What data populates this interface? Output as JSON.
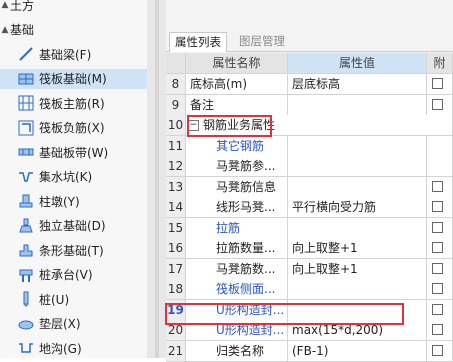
{
  "tree": {
    "items": [
      {
        "label": "土方",
        "icon": "folder-icon",
        "kind": "group"
      },
      {
        "label": "基础",
        "icon": "folder-icon",
        "kind": "group"
      },
      {
        "label": "基础梁(F)",
        "icon": "beam-icon",
        "kind": "item"
      },
      {
        "label": "筏板基础(M)",
        "icon": "raft-foundation-icon",
        "kind": "item",
        "selected": true
      },
      {
        "label": "筏板主筋(R)",
        "icon": "main-rebar-icon",
        "kind": "item"
      },
      {
        "label": "筏板负筋(X)",
        "icon": "negative-rebar-icon",
        "kind": "item"
      },
      {
        "label": "基础板带(W)",
        "icon": "slab-strip-icon",
        "kind": "item"
      },
      {
        "label": "集水坑(K)",
        "icon": "sump-pit-icon",
        "kind": "item"
      },
      {
        "label": "柱墩(Y)",
        "icon": "pier-icon",
        "kind": "item"
      },
      {
        "label": "独立基础(D)",
        "icon": "isolated-footing-icon",
        "kind": "item"
      },
      {
        "label": "条形基础(T)",
        "icon": "strip-footing-icon",
        "kind": "item"
      },
      {
        "label": "桩承台(V)",
        "icon": "pile-cap-icon",
        "kind": "item"
      },
      {
        "label": "桩(U)",
        "icon": "pile-icon",
        "kind": "item"
      },
      {
        "label": "垫层(X)",
        "icon": "cushion-icon",
        "kind": "item"
      },
      {
        "label": "地沟(G)",
        "icon": "trench-icon",
        "kind": "item"
      }
    ]
  },
  "panel": {
    "tabs": [
      {
        "label": "属性列表",
        "active": true
      },
      {
        "label": "图层管理",
        "active": false
      }
    ],
    "columns": {
      "name": "属性名称",
      "value": "属性值",
      "attach": "附"
    },
    "rows": [
      {
        "num": "8",
        "name": "底标高(m)",
        "value": "层底标高",
        "blue": false,
        "checkbox": true
      },
      {
        "num": "9",
        "name": "备注",
        "value": "",
        "blue": false,
        "checkbox": true
      },
      {
        "num": "10",
        "name": "钢筋业务属性",
        "value": "",
        "blue": false,
        "checkbox": false,
        "group": true
      },
      {
        "num": "11",
        "name": "其它钢筋",
        "value": "",
        "blue": true,
        "checkbox": false
      },
      {
        "num": "12",
        "name": "马凳筋参...",
        "value": "",
        "blue": false,
        "checkbox": false
      },
      {
        "num": "13",
        "name": "马凳筋信息",
        "value": "",
        "blue": false,
        "checkbox": true
      },
      {
        "num": "14",
        "name": "线形马凳...",
        "value": "平行横向受力筋",
        "blue": false,
        "checkbox": true
      },
      {
        "num": "15",
        "name": "拉筋",
        "value": "",
        "blue": true,
        "checkbox": true
      },
      {
        "num": "16",
        "name": "拉筋数量...",
        "value": "向上取整+1",
        "blue": false,
        "checkbox": true
      },
      {
        "num": "17",
        "name": "马凳筋数...",
        "value": "向上取整+1",
        "blue": false,
        "checkbox": true
      },
      {
        "num": "18",
        "name": "筏板侧面...",
        "value": "",
        "blue": true,
        "checkbox": true
      },
      {
        "num": "19",
        "name": "U形构造封...",
        "value": "",
        "blue": true,
        "checkbox": true,
        "highlight": true
      },
      {
        "num": "20",
        "name": "U形构造封...",
        "value": "max(15*d,200)",
        "blue": true,
        "checkbox": true
      },
      {
        "num": "21",
        "name": "归类名称",
        "value": "(FB-1)",
        "blue": false,
        "checkbox": true
      }
    ]
  },
  "colors": {
    "highlight_box": "#e0323a",
    "link_blue": "#2b56c8",
    "selection": "#cfe3f7"
  }
}
